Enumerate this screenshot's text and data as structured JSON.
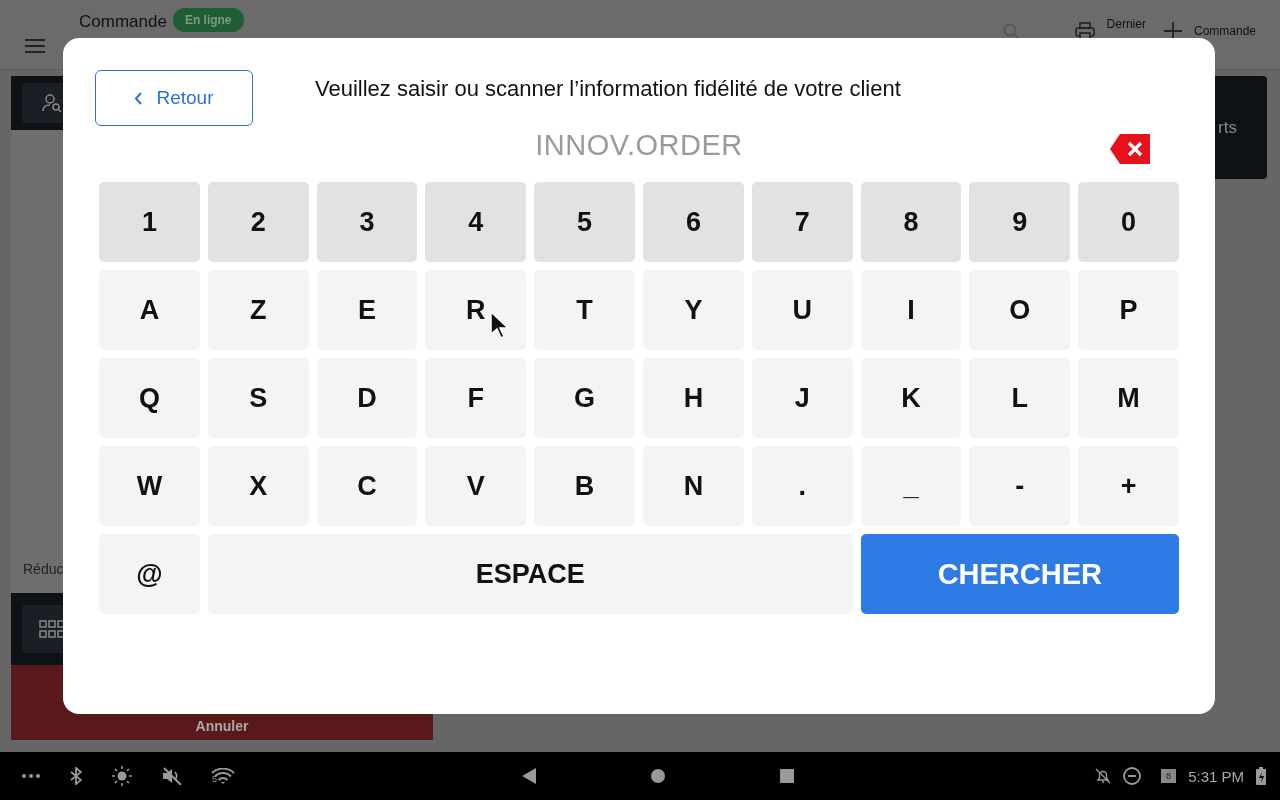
{
  "app_bar": {
    "title": "Commande",
    "status": "En ligne",
    "actions": [
      {
        "kind": "search"
      },
      {
        "kind": "print",
        "label": "Dernier"
      },
      {
        "kind": "add",
        "label": "Commande"
      }
    ]
  },
  "left_panel": {
    "discount_label": "Réduc",
    "cancel_button": "Annuler"
  },
  "right_panel": {
    "label": "rts"
  },
  "dialog": {
    "back_button": "Retour",
    "title": "Veuillez saisir ou scanner l’information fidélité de votre client",
    "field": {
      "value": "INNOV.ORDER"
    },
    "keys": [
      [
        {
          "label": "1",
          "kind": "digit"
        },
        {
          "label": "2",
          "kind": "digit"
        },
        {
          "label": "3",
          "kind": "digit"
        },
        {
          "label": "4",
          "kind": "digit"
        },
        {
          "label": "5",
          "kind": "digit"
        },
        {
          "label": "6",
          "kind": "digit"
        },
        {
          "label": "7",
          "kind": "digit"
        },
        {
          "label": "8",
          "kind": "digit"
        },
        {
          "label": "9",
          "kind": "digit"
        },
        {
          "label": "0",
          "kind": "digit"
        }
      ],
      [
        {
          "label": "A",
          "kind": "char"
        },
        {
          "label": "Z",
          "kind": "char"
        },
        {
          "label": "E",
          "kind": "char"
        },
        {
          "label": "R",
          "kind": "char"
        },
        {
          "label": "T",
          "kind": "char"
        },
        {
          "label": "Y",
          "kind": "char"
        },
        {
          "label": "U",
          "kind": "char"
        },
        {
          "label": "I",
          "kind": "char"
        },
        {
          "label": "O",
          "kind": "char"
        },
        {
          "label": "P",
          "kind": "char"
        }
      ],
      [
        {
          "label": "Q",
          "kind": "char"
        },
        {
          "label": "S",
          "kind": "char"
        },
        {
          "label": "D",
          "kind": "char"
        },
        {
          "label": "F",
          "kind": "char"
        },
        {
          "label": "G",
          "kind": "char"
        },
        {
          "label": "H",
          "kind": "char"
        },
        {
          "label": "J",
          "kind": "char"
        },
        {
          "label": "K",
          "kind": "char"
        },
        {
          "label": "L",
          "kind": "char"
        },
        {
          "label": "M",
          "kind": "char"
        }
      ],
      [
        {
          "label": "W",
          "kind": "char"
        },
        {
          "label": "X",
          "kind": "char"
        },
        {
          "label": "C",
          "kind": "char"
        },
        {
          "label": "V",
          "kind": "char"
        },
        {
          "label": "B",
          "kind": "char"
        },
        {
          "label": "N",
          "kind": "char"
        },
        {
          "label": ".",
          "kind": "char"
        },
        {
          "label": "_",
          "kind": "char"
        },
        {
          "label": "-",
          "kind": "char"
        },
        {
          "label": "+",
          "kind": "char"
        }
      ],
      [
        {
          "label": "@",
          "kind": "char"
        },
        {
          "label": "ESPACE",
          "kind": "space"
        },
        {
          "label": "CHERCHER",
          "kind": "search"
        }
      ]
    ]
  },
  "system_bar": {
    "wifi_band": "5",
    "notification_count": "8",
    "time": "5:31 PM"
  }
}
